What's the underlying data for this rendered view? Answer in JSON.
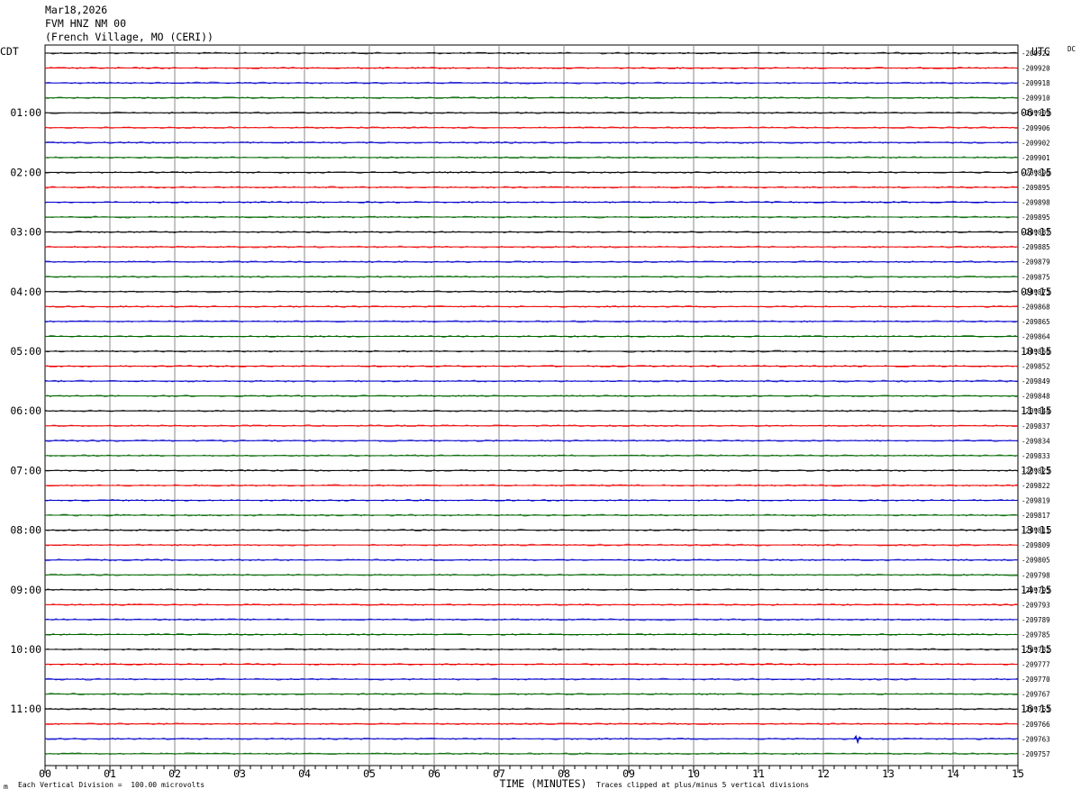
{
  "header": {
    "date": "Mar18,2026",
    "station": "FVM HNZ NM 00",
    "location": "(French Village, MO (CERI))"
  },
  "chart_data": {
    "type": "line",
    "title": "FVM HNZ NM 00",
    "left_axis_title": "CDT",
    "right_axis_title": "UTC",
    "right_corner_label": "DC",
    "xlabel": "TIME (MINUTES)",
    "x_range": [
      0,
      15
    ],
    "x_tick_labels": [
      "00",
      "01",
      "02",
      "03",
      "04",
      "05",
      "06",
      "07",
      "08",
      "09",
      "10",
      "11",
      "12",
      "13",
      "14",
      "15"
    ],
    "trace_colors": [
      "#000000",
      "#ee0000",
      "#0000cc",
      "#006600"
    ],
    "left_hour_labels": [
      "01:00",
      "02:00",
      "03:00",
      "04:00",
      "05:00",
      "06:00",
      "07:00",
      "08:00",
      "09:00",
      "10:00",
      "11:00"
    ],
    "right_hour_labels": [
      "06:15",
      "07:15",
      "08:15",
      "09:15",
      "10:15",
      "11:15",
      "12:15",
      "13:15",
      "14:15",
      "15:15",
      "16:15"
    ],
    "dc_offsets": [
      "-209922",
      "-209920",
      "-209918",
      "-209910",
      "-209909",
      "-209906",
      "-209902",
      "-209901",
      "-209896",
      "-209895",
      "-209898",
      "-209895",
      "-209887",
      "-209885",
      "-209879",
      "-209875",
      "-209873",
      "-209868",
      "-209865",
      "-209864",
      "-209856",
      "-209852",
      "-209849",
      "-209848",
      "-209844",
      "-209837",
      "-209834",
      "-209833",
      "-209825",
      "-209822",
      "-209819",
      "-209817",
      "-209811",
      "-209809",
      "-209805",
      "-209798",
      "-209795",
      "-209793",
      "-209789",
      "-209785",
      "-209782",
      "-209777",
      "-209770",
      "-209767",
      "-209763",
      "-209766",
      "-209763",
      "-209757"
    ],
    "footer_left": "Each Vertical Division =  100.00 microvolts",
    "footer_right": "Traces clipped at plus/minus 5 vertical divisions",
    "footer_mark": "m"
  }
}
